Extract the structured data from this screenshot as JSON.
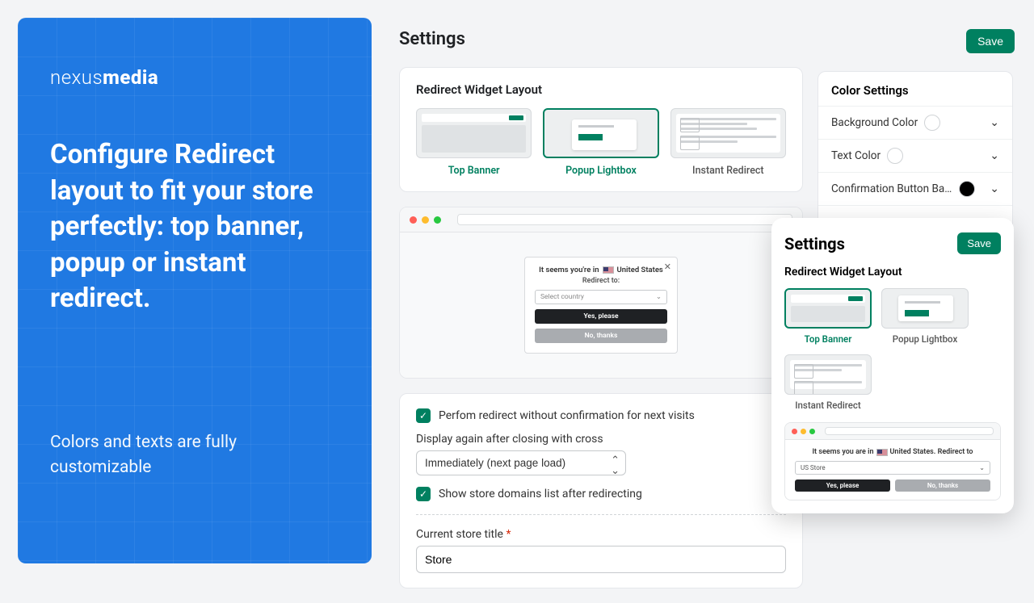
{
  "promo": {
    "brand_light": "nexus",
    "brand_bold": "media",
    "headline": "Configure Redirect layout to fit your store perfectly: top banner, popup or instant redirect.",
    "subline": "Colors and texts are fully customizable"
  },
  "page": {
    "title": "Settings",
    "save": "Save"
  },
  "widget_layout": {
    "title": "Redirect Widget Layout",
    "options": [
      {
        "label": "Top Banner"
      },
      {
        "label": "Popup Lightbox"
      },
      {
        "label": "Instant Redirect"
      }
    ],
    "selected_index": 1
  },
  "preview": {
    "heading_prefix": "It seems you're in",
    "country": "United States",
    "sub": "Redirect to:",
    "select_placeholder": "Select country",
    "yes": "Yes, please",
    "no": "No, thanks"
  },
  "options": {
    "cb1": "Perfom redirect without confirmation for next visits",
    "display_again_label": "Display again after closing with cross",
    "display_again_value": "Immediately (next page load)",
    "cb2": "Show store domains list after redirecting",
    "current_store_label": "Current store title",
    "current_store_value": "Store"
  },
  "color_settings": {
    "title": "Color Settings",
    "rows": [
      {
        "label": "Background Color",
        "swatch": "w"
      },
      {
        "label": "Text Color",
        "swatch": "w"
      },
      {
        "label": "Confirmation Button Backg...",
        "swatch": "k"
      }
    ]
  },
  "overlay": {
    "title": "Settings",
    "save": "Save",
    "section": "Redirect Widget Layout",
    "options": [
      {
        "label": "Top Banner"
      },
      {
        "label": "Popup Lightbox"
      },
      {
        "label": "Instant Redirect"
      }
    ],
    "selected_index": 0,
    "preview": {
      "heading_prefix": "It seems you are in",
      "country_suffix": "United States. Redirect to",
      "select_value": "US Store",
      "yes": "Yes, please",
      "no": "No, thanks"
    }
  }
}
